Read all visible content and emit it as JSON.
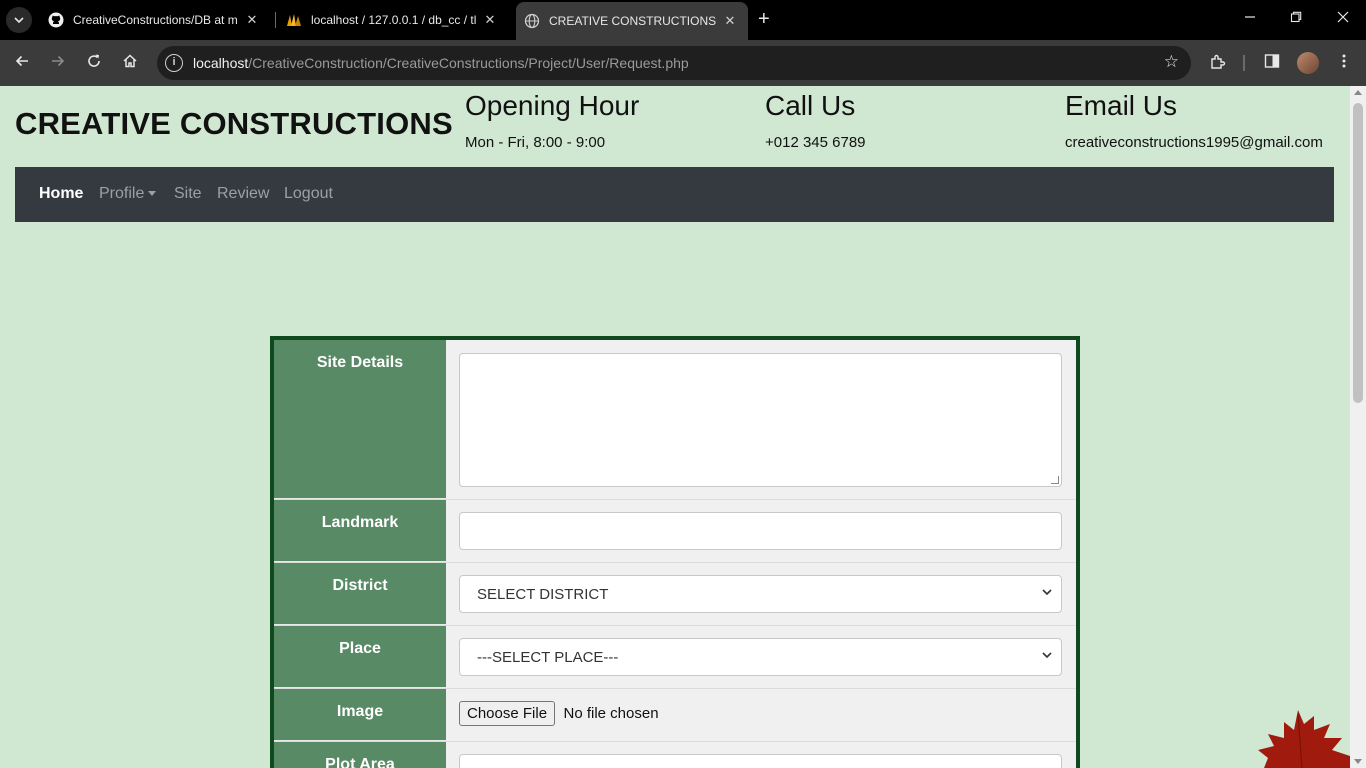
{
  "browser": {
    "tabs": [
      {
        "title": "CreativeConstructions/DB at m",
        "icon": "github-icon"
      },
      {
        "title": "localhost / 127.0.0.1 / db_cc / tl",
        "icon": "phpmyadmin-icon"
      },
      {
        "title": "CREATIVE CONSTRUCTIONS",
        "icon": "globe-icon"
      }
    ],
    "url_host": "localhost",
    "url_path": "/CreativeConstruction/CreativeConstructions/Project/User/Request.php"
  },
  "header": {
    "brand": "CREATIVE CONSTRUCTIONS",
    "opening_title": "Opening Hour",
    "opening_value": "Mon - Fri, 8:00 - 9:00",
    "call_title": "Call Us",
    "call_value": "+012 345 6789",
    "email_title": "Email Us",
    "email_value": "creativeconstructions1995@gmail.com"
  },
  "nav": {
    "home": "Home",
    "profile": "Profile",
    "site": "Site",
    "review": "Review",
    "logout": "Logout"
  },
  "form": {
    "site_details_label": "Site Details",
    "landmark_label": "Landmark",
    "district_label": "District",
    "district_value": "SELECT DISTRICT",
    "place_label": "Place",
    "place_value": "---SELECT PLACE---",
    "image_label": "Image",
    "file_button": "Choose File",
    "file_status": "No file chosen",
    "plot_area_label": "Plot Area"
  },
  "colors": {
    "page_bg": "#d0e7d2",
    "navbar": "#343a40",
    "label_bg": "#588a65",
    "form_border": "#0f4a1e"
  }
}
